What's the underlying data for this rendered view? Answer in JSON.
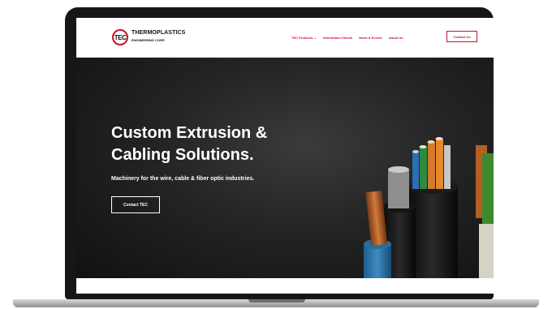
{
  "brand": {
    "mark": "TEC",
    "name_line1": "THERMOPLASTICS",
    "name_line2": "ENGINEERING CORP."
  },
  "nav": {
    "items": [
      "TEC Products ⌄",
      "Information Sheets",
      "News & Events",
      "About Us"
    ],
    "cta": "Contact Us"
  },
  "hero": {
    "title": "Custom Extrusion & Cabling Solutions.",
    "subtitle": "Machinery for the wire, cable & fiber optic industries.",
    "button": "Contact TEC"
  },
  "colors": {
    "accent": "#c8102e",
    "hero_bg": "#242424",
    "laptop_frame": "#161616"
  }
}
